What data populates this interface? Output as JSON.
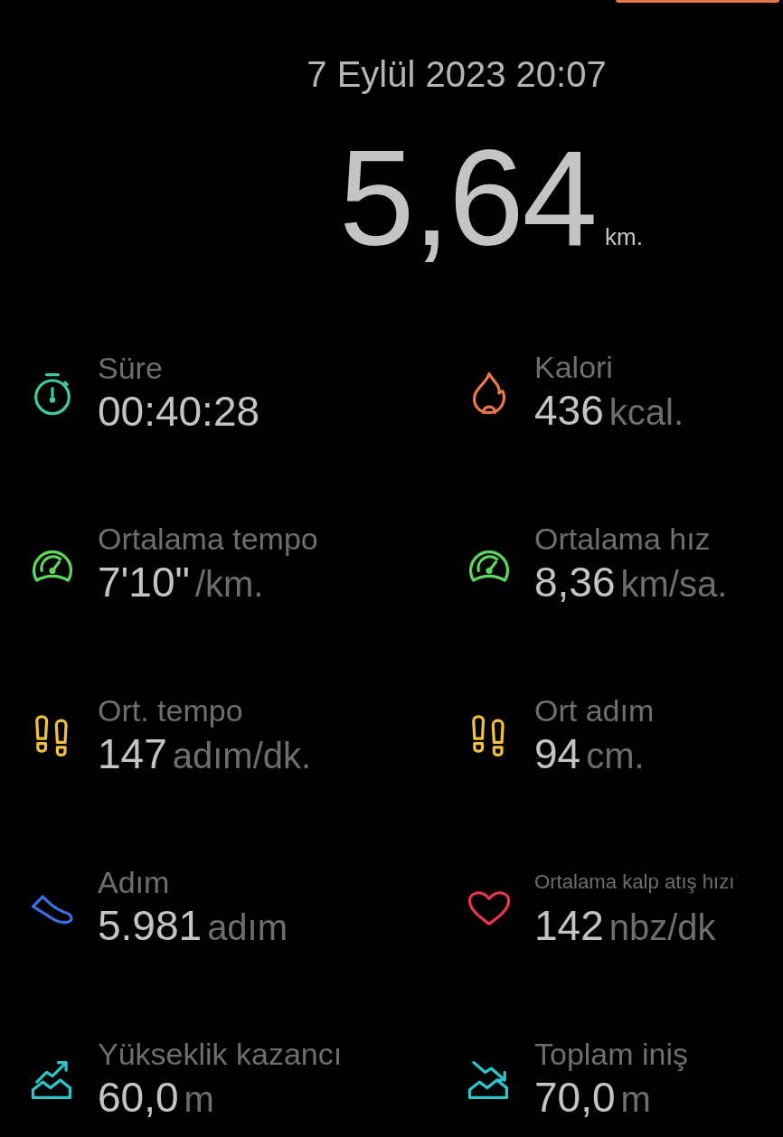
{
  "date": "7 Eylül 2023 20:07",
  "distance": {
    "value": "5,64",
    "unit": "km."
  },
  "metrics": [
    {
      "kind": "stopwatch",
      "color": "#3ec9a0",
      "label": "Süre",
      "value": "00:40:28"
    },
    {
      "kind": "flame",
      "color": "#e8784a",
      "label": "Kalori",
      "value": "436",
      "unit": "kcal."
    },
    {
      "kind": "gauge",
      "color": "#5cd65c",
      "label": "Ortalama tempo",
      "value": "7'10\"",
      "unit": "/km."
    },
    {
      "kind": "gauge",
      "color": "#5cd65c",
      "label": "Ortalama hız",
      "value": "8,36",
      "unit": "km/sa."
    },
    {
      "kind": "footprints",
      "color": "#f0c040",
      "label": "Ort. tempo",
      "value": "147",
      "unit": "adım/dk."
    },
    {
      "kind": "footprints",
      "color": "#f0c040",
      "label": "Ort adım",
      "value": "94",
      "unit": "cm."
    },
    {
      "kind": "shoe",
      "color": "#3a6fe0",
      "label": "Adım",
      "value": "5.981",
      "unit": "adım"
    },
    {
      "kind": "heart",
      "color": "#e8354f",
      "label": "Ortalama kalp atış hızı",
      "value": "142",
      "unit": "nbz/dk"
    },
    {
      "kind": "ascent",
      "color": "#2fc4c8",
      "label": "Yükseklik kazancı",
      "value": "60,0",
      "unit": "m"
    },
    {
      "kind": "descent",
      "color": "#2fc4c8",
      "label": "Toplam iniş",
      "value": "70,0",
      "unit": "m"
    }
  ]
}
